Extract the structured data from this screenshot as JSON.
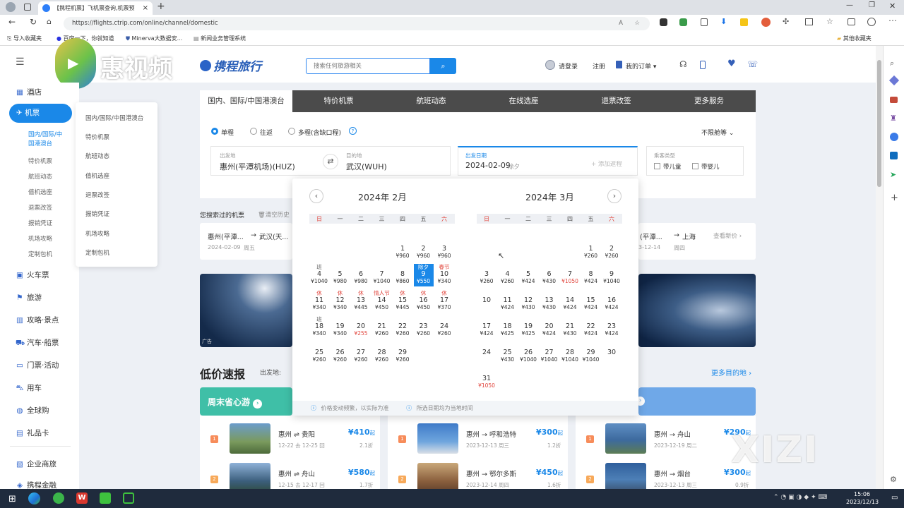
{
  "browser": {
    "tab_title": "【携程机票】飞机票查询,机票预",
    "url": "https://flights.ctrip.com/online/channel/domestic",
    "bookmarks": [
      "导入收藏夹",
      "百度一下，你就知道",
      "Minerva大数据安...",
      "新闻业务管理系统"
    ],
    "other_bookmarks": "其他收藏夹"
  },
  "watermark_logo": "惠视频",
  "watermark_xizi": "XIZI",
  "site": {
    "logo": "携程旅行",
    "search_placeholder": "搜索任何旅游相关",
    "login": "请登录",
    "register": "注册",
    "orders": "我的订单"
  },
  "leftnav": {
    "items": [
      "酒店",
      "机票",
      "火车票",
      "旅游",
      "攻略·景点",
      "汽车·船票",
      "门票·活动",
      "用车",
      "全球购",
      "礼品卡",
      "企业商旅",
      "携程金融"
    ],
    "active_sub": [
      "国内/国际/中",
      "国港澳台"
    ],
    "subs": [
      "特价机票",
      "航班动态",
      "值机选座",
      "退票改签",
      "报销凭证",
      "机场攻略",
      "定制包机"
    ]
  },
  "submenu": [
    "国内/国际/中国港澳台",
    "特价机票",
    "航班动态",
    "值机选座",
    "退票改签",
    "报销凭证",
    "机场攻略",
    "定制包机"
  ],
  "tabs": [
    "国内、国际/中国港澳台",
    "特价机票",
    "航班动态",
    "在线选座",
    "退票改签",
    "更多服务"
  ],
  "trip_types": [
    "单程",
    "往返",
    "多程(含缺口程)"
  ],
  "cabin": "不限舱等",
  "form": {
    "from_label": "出发地",
    "from_value": "惠州(平潭机场)(HUZ)",
    "to_label": "目的地",
    "to_value": "武汉(WUH)",
    "date_label": "出发日期",
    "date_value": "2024-02-09",
    "date_note": "除夕",
    "add_return": "+ 添加返程",
    "pax_label": "乘客类型",
    "child": "带儿童",
    "infant": "带婴儿"
  },
  "history": {
    "title": "您搜索过的机票",
    "clear": "清空历史",
    "item1_route": "惠州(平潭...",
    "item1_arrow": "→",
    "item1_to": "武汉(天...",
    "item1_date": "2024-02-09",
    "item1_week": "周五",
    "item2_route": "(平潭...",
    "item2_to": "上海",
    "item2_date": "3-12-14",
    "item2_week": "周四",
    "check_price": "查看新价 ›"
  },
  "calendar": {
    "weekdays": [
      "日",
      "一",
      "二",
      "三",
      "四",
      "五",
      "六"
    ],
    "feb": {
      "title": "2024年 2月",
      "days": [
        {
          "d": "1",
          "p": "¥960",
          "t": ""
        },
        {
          "d": "2",
          "p": "¥960",
          "t": ""
        },
        {
          "d": "3",
          "p": "¥960",
          "t": ""
        },
        {
          "d": "4",
          "p": "¥1040",
          "t": "班"
        },
        {
          "d": "5",
          "p": "¥980",
          "t": ""
        },
        {
          "d": "6",
          "p": "¥980",
          "t": ""
        },
        {
          "d": "7",
          "p": "¥1040",
          "t": ""
        },
        {
          "d": "8",
          "p": "¥860",
          "t": ""
        },
        {
          "d": "9",
          "p": "¥550",
          "t": "除夕"
        },
        {
          "d": "10",
          "p": "¥340",
          "t": "春节"
        },
        {
          "d": "11",
          "p": "¥340",
          "t": "休"
        },
        {
          "d": "12",
          "p": "¥340",
          "t": "休"
        },
        {
          "d": "13",
          "p": "¥445",
          "t": "休"
        },
        {
          "d": "14",
          "p": "¥450",
          "t": "情人节"
        },
        {
          "d": "15",
          "p": "¥445",
          "t": "休"
        },
        {
          "d": "16",
          "p": "¥450",
          "t": "休"
        },
        {
          "d": "17",
          "p": "¥370",
          "t": "休"
        },
        {
          "d": "18",
          "p": "¥340",
          "t": "班"
        },
        {
          "d": "19",
          "p": "¥340",
          "t": ""
        },
        {
          "d": "20",
          "p": "¥255",
          "t": ""
        },
        {
          "d": "21",
          "p": "¥260",
          "t": ""
        },
        {
          "d": "22",
          "p": "¥260",
          "t": ""
        },
        {
          "d": "23",
          "p": "¥260",
          "t": ""
        },
        {
          "d": "24",
          "p": "¥260",
          "t": ""
        },
        {
          "d": "25",
          "p": "¥260",
          "t": ""
        },
        {
          "d": "26",
          "p": "¥260",
          "t": ""
        },
        {
          "d": "27",
          "p": "¥260",
          "t": ""
        },
        {
          "d": "28",
          "p": "¥260",
          "t": ""
        },
        {
          "d": "29",
          "p": "¥260",
          "t": ""
        }
      ]
    },
    "mar": {
      "title": "2024年 3月",
      "days": [
        {
          "d": "1",
          "p": "¥260",
          "t": ""
        },
        {
          "d": "2",
          "p": "¥260",
          "t": ""
        },
        {
          "d": "3",
          "p": "¥260",
          "t": ""
        },
        {
          "d": "4",
          "p": "¥260",
          "t": ""
        },
        {
          "d": "5",
          "p": "¥424",
          "t": ""
        },
        {
          "d": "6",
          "p": "¥430",
          "t": ""
        },
        {
          "d": "7",
          "p": "¥1050",
          "t": ""
        },
        {
          "d": "8",
          "p": "¥424",
          "t": ""
        },
        {
          "d": "9",
          "p": "¥1040",
          "t": ""
        },
        {
          "d": "10",
          "p": "",
          "t": ""
        },
        {
          "d": "11",
          "p": "¥424",
          "t": ""
        },
        {
          "d": "12",
          "p": "¥430",
          "t": ""
        },
        {
          "d": "13",
          "p": "¥430",
          "t": ""
        },
        {
          "d": "14",
          "p": "¥424",
          "t": ""
        },
        {
          "d": "15",
          "p": "¥424",
          "t": ""
        },
        {
          "d": "16",
          "p": "¥424",
          "t": ""
        },
        {
          "d": "17",
          "p": "¥424",
          "t": ""
        },
        {
          "d": "18",
          "p": "¥425",
          "t": ""
        },
        {
          "d": "19",
          "p": "¥425",
          "t": ""
        },
        {
          "d": "20",
          "p": "¥424",
          "t": ""
        },
        {
          "d": "21",
          "p": "¥430",
          "t": ""
        },
        {
          "d": "22",
          "p": "¥424",
          "t": ""
        },
        {
          "d": "23",
          "p": "¥424",
          "t": ""
        },
        {
          "d": "24",
          "p": "",
          "t": ""
        },
        {
          "d": "25",
          "p": "¥430",
          "t": ""
        },
        {
          "d": "26",
          "p": "¥1040",
          "t": ""
        },
        {
          "d": "27",
          "p": "¥1040",
          "t": ""
        },
        {
          "d": "28",
          "p": "¥1040",
          "t": ""
        },
        {
          "d": "29",
          "p": "¥1040",
          "t": ""
        },
        {
          "d": "30",
          "p": "",
          "t": ""
        },
        {
          "d": "31",
          "p": "¥1050",
          "t": ""
        }
      ]
    },
    "foot1": "价格变动频繁，以实际为准",
    "foot2": "所选日期均为当地时间"
  },
  "lowprice": {
    "title": "低价速报",
    "from_label": "出发地:",
    "more": "更多目的地 ›",
    "weekend": "周末省心游",
    "ad": "广告",
    "col1": [
      {
        "route": "惠州 ⇌ 贵阳",
        "date": "12-22 去 12-25 回",
        "price": "¥410",
        "unit": "起",
        "disc": "2.1折",
        "rank": "1"
      },
      {
        "route": "惠州 ⇌ 舟山",
        "date": "12-15 去 12-17 回",
        "price": "¥580",
        "unit": "起",
        "disc": "1.7折",
        "rank": "2"
      }
    ],
    "col2": [
      {
        "route": "惠州 → 呼和浩特",
        "date": "2023-12-13 周三",
        "price": "¥300",
        "unit": "起",
        "disc": "1.2折",
        "rank": "1"
      },
      {
        "route": "惠州 → 鄂尔多斯",
        "date": "2023-12-14 周四",
        "price": "¥450",
        "unit": "起",
        "disc": "1.6折",
        "rank": "2"
      }
    ],
    "col3": [
      {
        "route": "惠州 → 舟山",
        "date": "2023-12-19 周二",
        "price": "¥290",
        "unit": "起",
        "disc": "",
        "rank": "1"
      },
      {
        "route": "惠州 → 烟台",
        "date": "2023-12-13 周三",
        "price": "¥300",
        "unit": "起",
        "disc": "0.9折",
        "rank": "2"
      }
    ]
  },
  "taskbar": {
    "time": "15:06",
    "date": "2023/12/13"
  }
}
